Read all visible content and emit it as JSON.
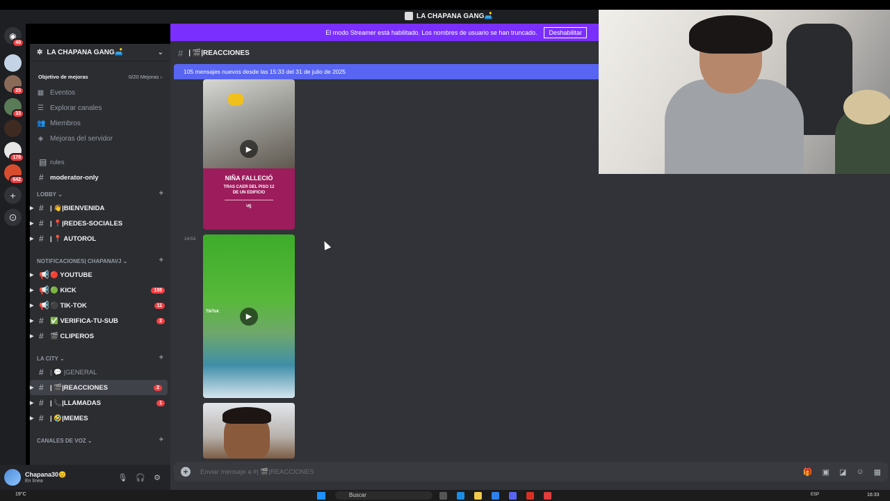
{
  "window": {
    "title": "LA CHAPANA GANG🛋️"
  },
  "rail": {
    "badges": [
      "49",
      "25",
      "33",
      "178",
      "642"
    ]
  },
  "server": {
    "name": "LA CHAPANA GANG🛋️",
    "boost_label": "Objetivo de mejoras",
    "boost_value": "0/20 Mejoras",
    "menu": [
      "Eventos",
      "Explorar canales",
      "Miembros",
      "Mejoras del servidor"
    ]
  },
  "channels": {
    "top": [
      {
        "name": "rules"
      },
      {
        "name": "moderator-only"
      }
    ],
    "categories": [
      {
        "name": "LOBBY",
        "items": [
          {
            "name": "| 👋|BIENVENIDA",
            "count": ""
          },
          {
            "name": "| 📍|REDES-SOCIALES",
            "count": ""
          },
          {
            "name": "| 📍 AUTOROL",
            "count": ""
          }
        ]
      },
      {
        "name": "NOTIFICACIONES| CHAPANAVJ",
        "items": [
          {
            "name": "🔴 YOUTUBE",
            "count": ""
          },
          {
            "name": "🟢 KICK",
            "count": "155"
          },
          {
            "name": "⚫ TIK-TOK",
            "count": "11"
          },
          {
            "name": "✅ VERIFICA-TU-SUB",
            "count": "2"
          },
          {
            "name": "🎬 CLIPEROS",
            "count": ""
          }
        ]
      },
      {
        "name": "LA CITY",
        "items": [
          {
            "name": "| 💬 |GENERAL",
            "count": ""
          },
          {
            "name": "| 🎬|REACCIONES",
            "count": "2"
          },
          {
            "name": "| 📞|LLAMADAS",
            "count": "1"
          },
          {
            "name": "| 🤣|MEMES",
            "count": ""
          }
        ]
      },
      {
        "name": "CANALES DE VOZ",
        "items": []
      }
    ]
  },
  "user": {
    "name": "Chapana30😊",
    "status": "En línea"
  },
  "streamer_banner": {
    "text": "El modo Streamer está habilitado. Los nombres de usuario se han truncado.",
    "button": "Deshabilitar"
  },
  "channel_header": {
    "name": "| 🎬|REACCIONES"
  },
  "new_messages": "105 mensajes nuevos desde las 15:33 del 31 de julio de 2025",
  "messages": {
    "timestamp": "14:53",
    "media1": {
      "headline": "NIÑA FALLECIÓ",
      "sub1": "TRAS CAER DEL PISO 12",
      "sub2": "DE UN EDIFICIO",
      "logo": "ᥙᦋ"
    },
    "media2": {
      "tag": "TikTok"
    }
  },
  "composer": {
    "placeholder": "Enviar mensaje a #| 🎬|REACCIONES"
  },
  "taskbar": {
    "weather": "19°C",
    "search": "Buscar",
    "lang": "ESP",
    "time": "16:33"
  }
}
